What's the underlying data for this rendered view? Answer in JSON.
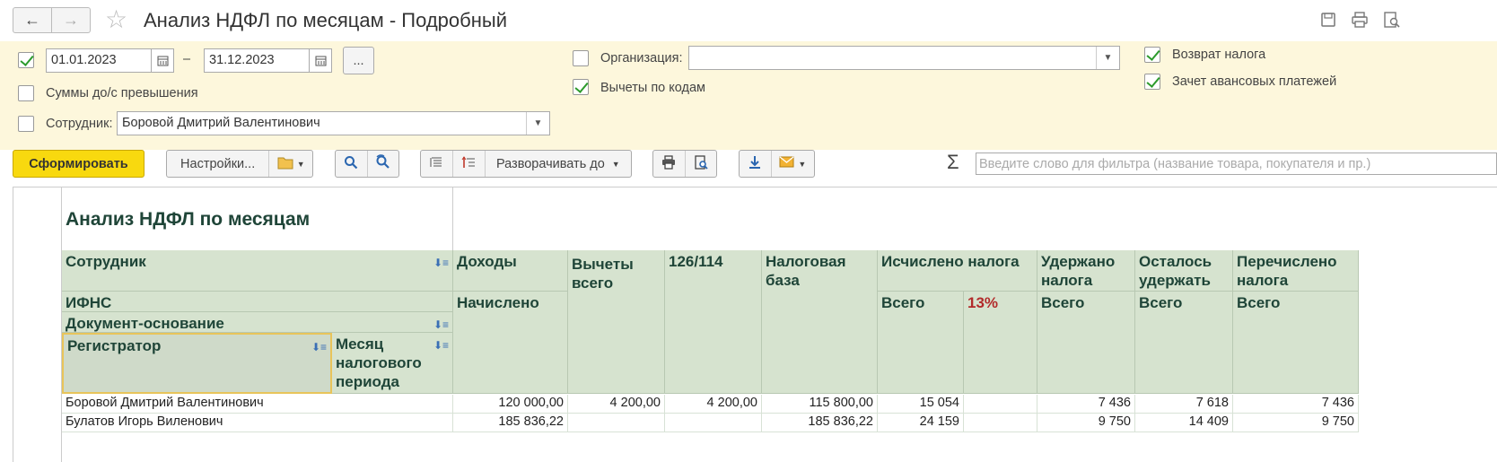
{
  "window": {
    "title": "Анализ НДФЛ по месяцам - Подробный",
    "back_icon": "arrow-left-icon",
    "forward_icon": "arrow-right-icon",
    "favorite_icon": "star-icon"
  },
  "filters": {
    "period": {
      "checked": true,
      "from": "01.01.2023",
      "dash": "–",
      "to": "31.12.2023",
      "more_label": "..."
    },
    "sums_over": {
      "checked": false,
      "label": "Суммы до/с превышения"
    },
    "employee": {
      "checked": false,
      "label": "Сотрудник:",
      "value": "Боровой Дмитрий Валентинович"
    },
    "organization": {
      "checked": false,
      "label": "Организация:",
      "value": ""
    },
    "deductions_by_codes": {
      "checked": true,
      "label": "Вычеты по кодам"
    },
    "tax_return": {
      "checked": true,
      "label": "Возврат налога"
    },
    "advance_offset": {
      "checked": true,
      "label": "Зачет авансовых платежей"
    }
  },
  "toolbar": {
    "generate_label": "Сформировать",
    "settings_label": "Настройки...",
    "expand_label": "Разворачивать до",
    "search_placeholder": "Введите слово для фильтра (название товара, покупателя и пр.)",
    "sigma": "Σ"
  },
  "report": {
    "title": "Анализ НДФЛ по месяцам",
    "headers": {
      "employee": "Сотрудник",
      "ifns": "ИФНС",
      "base_document": "Документ-основание",
      "registrar": "Регистратор",
      "tax_period_month": "Месяц налогового периода",
      "income": "Доходы",
      "accrued": "Начислено",
      "deductions_total": "Вычеты всего",
      "code_126_114": "126/114",
      "tax_base": "Налоговая база",
      "tax_calculated": "Исчислено налога",
      "total_1": "Всего",
      "rate_13": "13%",
      "tax_withheld": "Удержано налога",
      "total_2": "Всего",
      "left_to_withhold": "Осталось удержать",
      "total_3": "Всего",
      "tax_transferred": "Перечислено налога",
      "total_4": "Всего"
    },
    "rows": [
      {
        "name": "Боровой Дмитрий Валентинович",
        "accrued": "120 000,00",
        "deductions": "4 200,00",
        "c126": "4 200,00",
        "base": "115 800,00",
        "calc": "15 054",
        "r13": "",
        "withheld": "7 436",
        "left": "7 618",
        "transferred": "7 436"
      },
      {
        "name": "Булатов Игорь Виленович",
        "accrued": "185 836,22",
        "deductions": "",
        "c126": "",
        "base": "185 836,22",
        "calc": "24 159",
        "r13": "",
        "withheld": "9 750",
        "left": "14 409",
        "transferred": "9 750"
      }
    ]
  },
  "colors": {
    "panel_bg": "#fdf7dc",
    "header_bg": "#d6e3cf",
    "primary_btn": "#f8d90f",
    "check": "#2c9b2c"
  }
}
